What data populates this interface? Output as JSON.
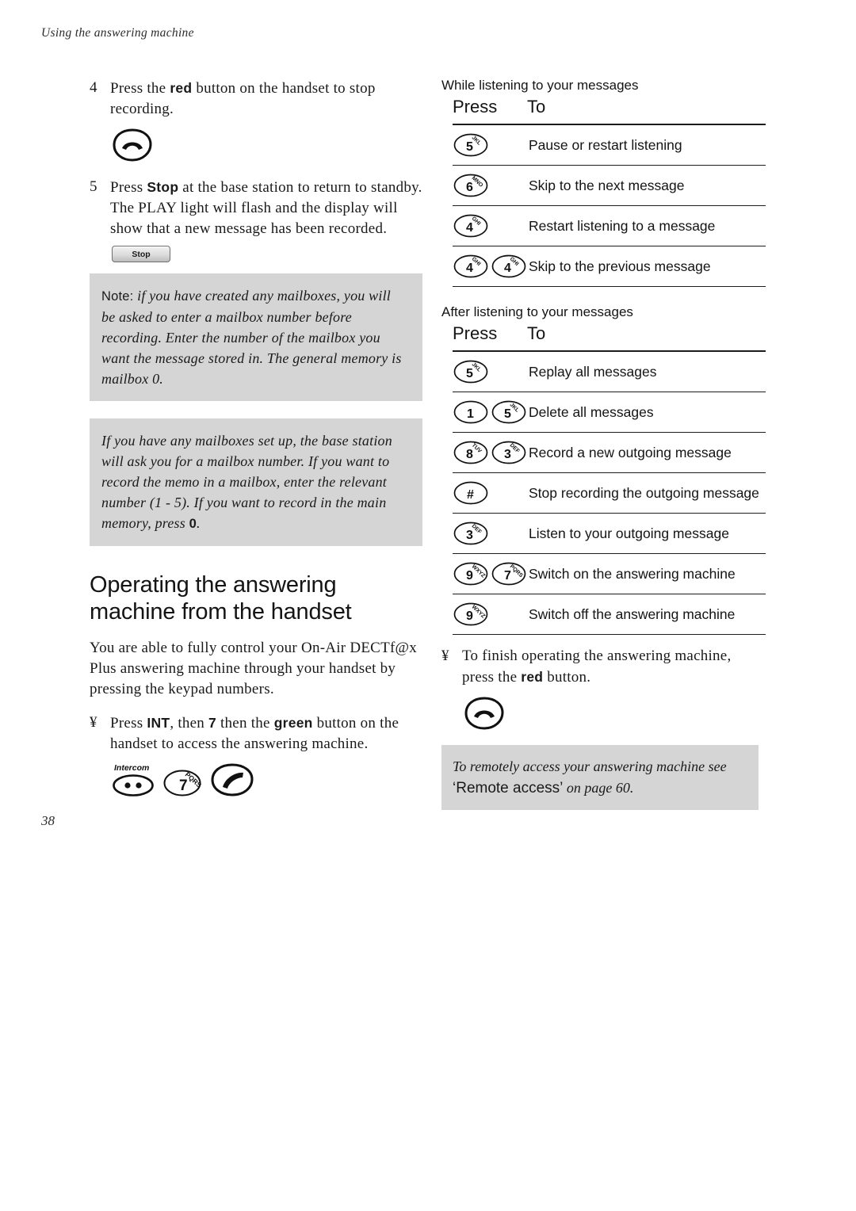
{
  "running_head": "Using the answering machine",
  "page_number": "38",
  "left_column": {
    "steps": [
      {
        "number": "4",
        "text_parts": [
          "Press the ",
          "red",
          " button on the handset to stop recording."
        ],
        "icon": "hang-up-key"
      },
      {
        "number": "5",
        "text_parts": [
          "Press ",
          "Stop",
          " at the base station to return to standby. The PLAY light will flash and the display will show that a new message has been recorded."
        ],
        "icon": "stop-button",
        "stop_button_label": "Stop"
      }
    ],
    "note_box": {
      "label": "Note:",
      "text": "if you have created any mailboxes, you will be asked to enter a mailbox number before recording. Enter the number of the mailbox you want the message stored in. The general memory is mailbox 0."
    },
    "mailbox_box": {
      "text_before": "If you have any mailboxes set up, the base station will ask you for a mailbox number. If you want to record the memo in a mailbox, enter the relevant number (1 - 5). If you want to record in the main memory, press ",
      "bold_value": "0",
      "text_after": "."
    },
    "heading": "Operating the answering machine from the handset",
    "intro_paragraph": "You are able to fully control your On-Air DECTf@x Plus answering machine through your handset by pressing the keypad numbers.",
    "bullet": {
      "marker": "¥",
      "parts": [
        "Press ",
        "INT",
        ", then ",
        "7",
        " then the ",
        "green",
        " button on the handset to access the answering machine."
      ],
      "keys": [
        "intercom-key",
        "7-key",
        "pick-up-key"
      ],
      "intercom_caption": "Intercom",
      "key7_digit": "7",
      "key7_letters": "PQRS"
    }
  },
  "right_column": {
    "table_while": {
      "caption": "While listening to your messages",
      "headers": {
        "press": "Press",
        "to": "To"
      },
      "rows": [
        {
          "keys": [
            {
              "digit": "5",
              "letters": "JKL"
            }
          ],
          "to": "Pause or restart listening"
        },
        {
          "keys": [
            {
              "digit": "6",
              "letters": "MNO"
            }
          ],
          "to": "Skip to the next message"
        },
        {
          "keys": [
            {
              "digit": "4",
              "letters": "GHI"
            }
          ],
          "to": "Restart listening to a message"
        },
        {
          "keys": [
            {
              "digit": "4",
              "letters": "GHI"
            },
            {
              "digit": "4",
              "letters": "GHI"
            }
          ],
          "to": "Skip to the previous message"
        }
      ]
    },
    "table_after": {
      "caption": "After listening to your messages",
      "headers": {
        "press": "Press",
        "to": "To"
      },
      "rows": [
        {
          "keys": [
            {
              "digit": "5",
              "letters": "JKL"
            }
          ],
          "to": "Replay all messages"
        },
        {
          "keys": [
            {
              "digit": "1",
              "letters": ""
            },
            {
              "digit": "5",
              "letters": "JKL"
            }
          ],
          "to": "Delete all messages"
        },
        {
          "keys": [
            {
              "digit": "8",
              "letters": "TUV"
            },
            {
              "digit": "3",
              "letters": "DEF"
            }
          ],
          "to": "Record a new outgoing message"
        },
        {
          "keys": [
            {
              "digit": "#",
              "letters": ""
            }
          ],
          "to": "Stop recording the outgoing message"
        },
        {
          "keys": [
            {
              "digit": "3",
              "letters": "DEF"
            }
          ],
          "to": "Listen to your outgoing message"
        },
        {
          "keys": [
            {
              "digit": "9",
              "letters": "WXYZ"
            },
            {
              "digit": "7",
              "letters": "PQRS"
            }
          ],
          "to": "Switch on the answering machine"
        },
        {
          "keys": [
            {
              "digit": "9",
              "letters": "WXYZ"
            }
          ],
          "to": "Switch off the answering machine"
        }
      ]
    },
    "finish_bullet": {
      "marker": "¥",
      "parts": [
        "To finish operating the answering machine, press the ",
        "red",
        " button."
      ],
      "icon": "hang-up-key"
    },
    "ref_box": {
      "text_before": "To remotely access your answering machine see ",
      "quoted": "‘Remote access’",
      "text_after": " on page 60."
    }
  },
  "colors": {
    "note_box_bg": "#d5d5d5",
    "rule": "#1c1c1c",
    "text": "#1a1a1a"
  }
}
